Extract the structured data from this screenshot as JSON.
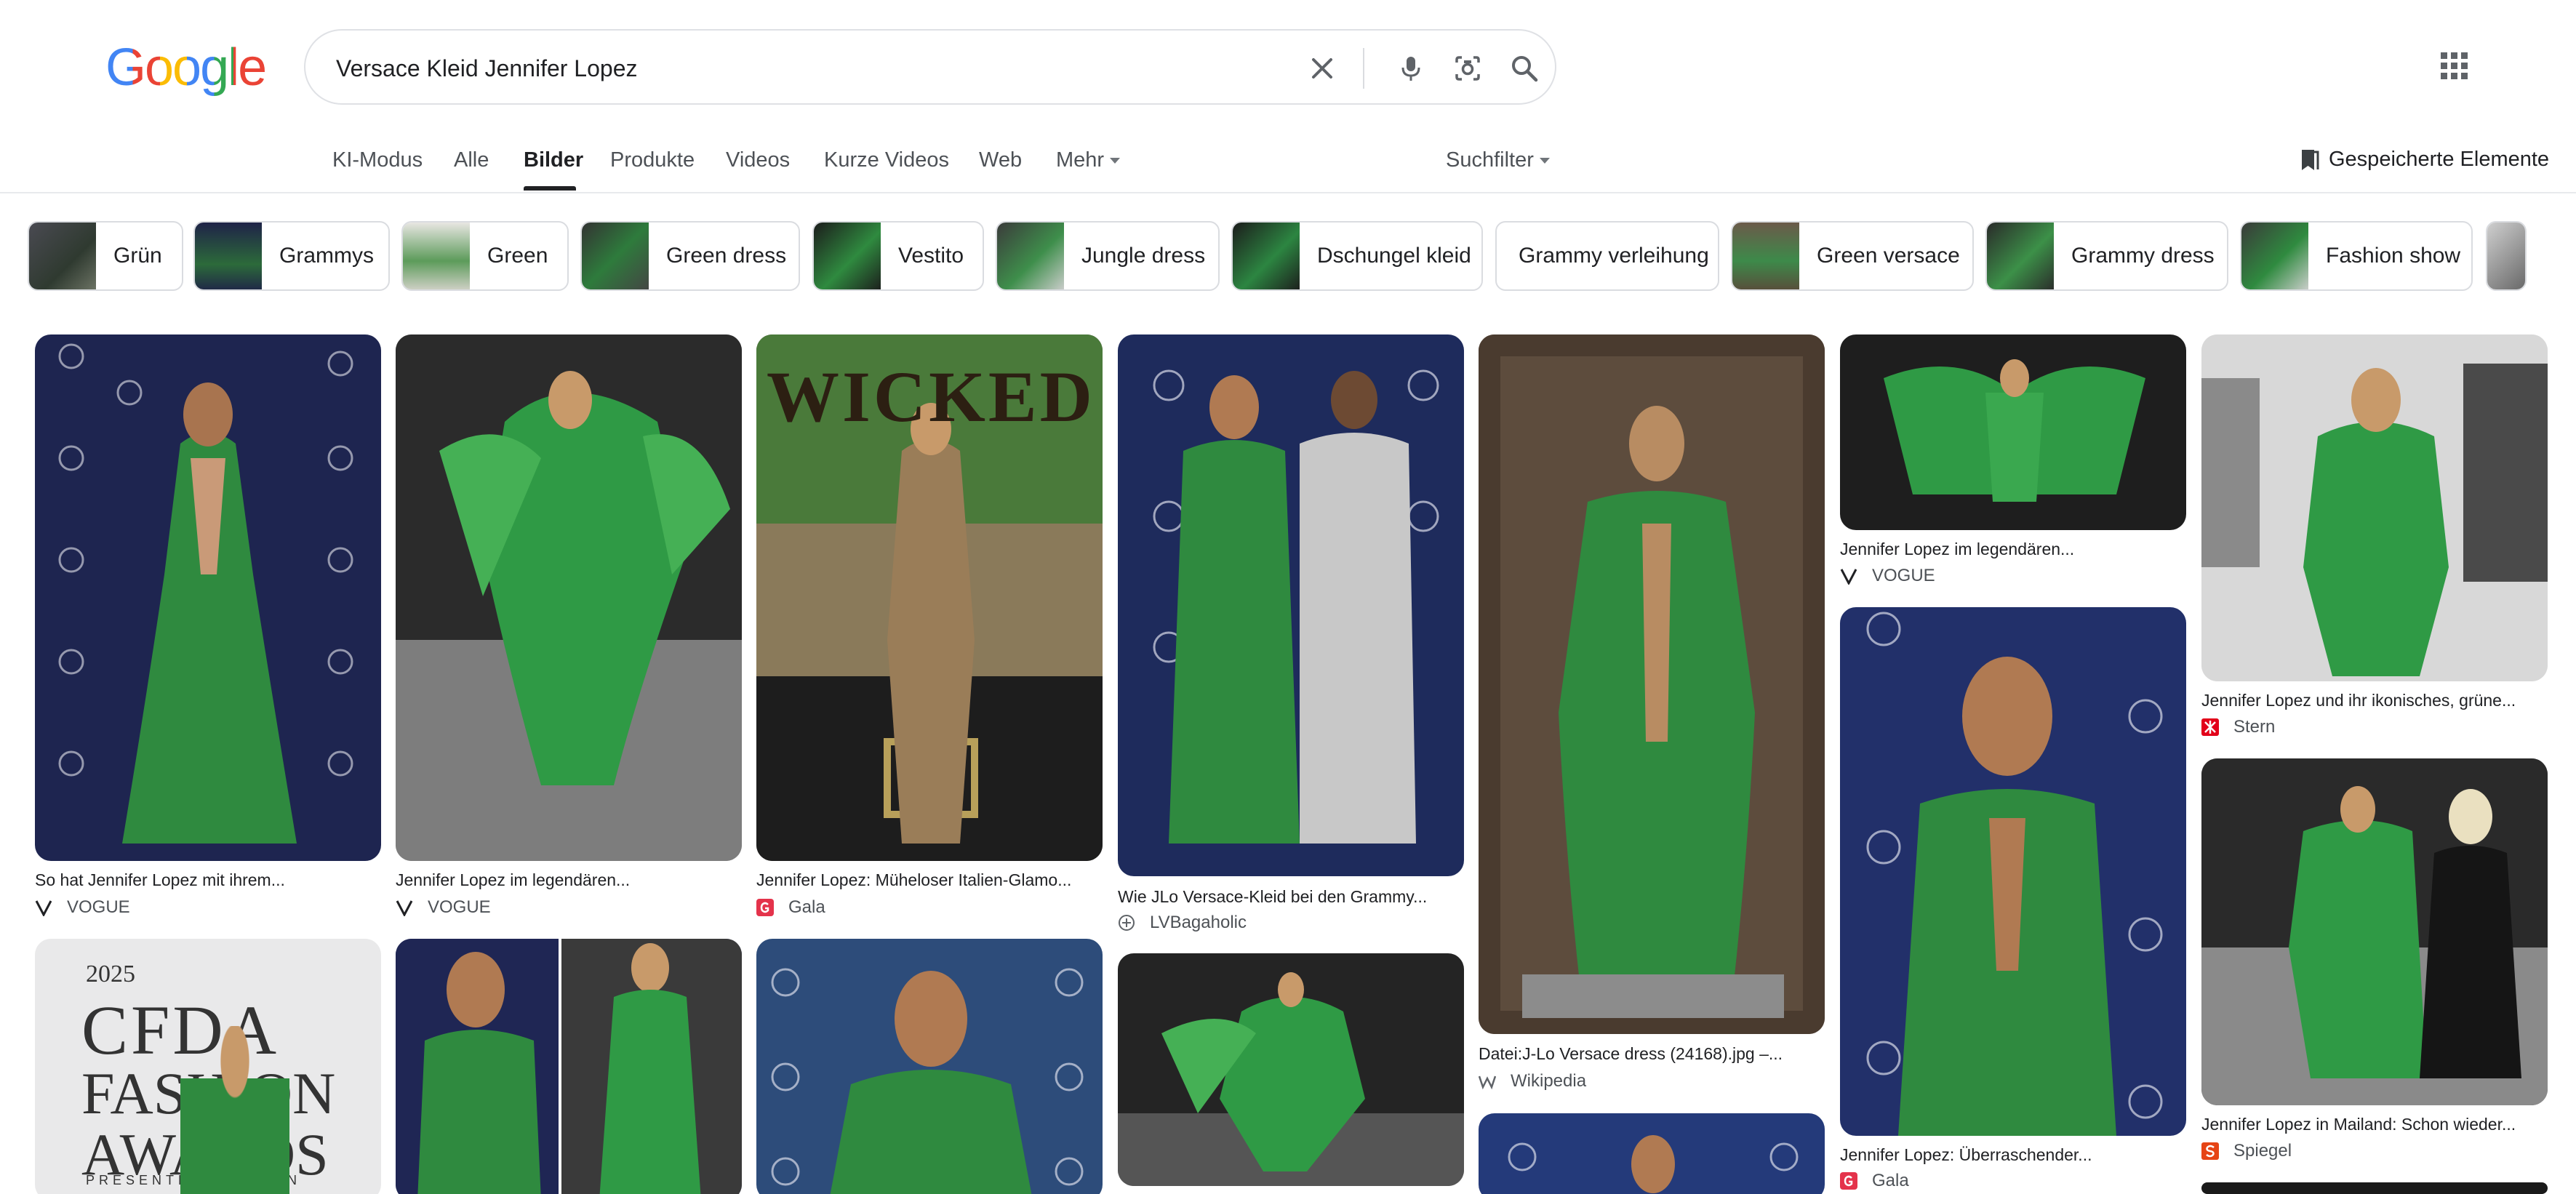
{
  "logo_text": "Google",
  "logo_colors": [
    "#4285f4",
    "#ea4335",
    "#fbbc05",
    "#4285f4",
    "#34a853",
    "#ea4335"
  ],
  "search": {
    "query": "Versace Kleid Jennifer Lopez"
  },
  "icons": {
    "clear": "close-icon",
    "voice": "microphone-icon",
    "lens": "lens-icon",
    "search": "search-icon",
    "apps": "apps-grid-icon",
    "saved": "bookmark-icon"
  },
  "nav": {
    "tabs": [
      "KI-Modus",
      "Alle",
      "Bilder",
      "Produkte",
      "Videos",
      "Kurze Videos",
      "Web",
      "Mehr"
    ],
    "active": "Bilder",
    "filter_label": "Suchfilter",
    "saved_label": "Gespeicherte Elemente"
  },
  "chips": [
    "Grün",
    "Grammys",
    "Green",
    "Green dress",
    "Vestito",
    "Jungle dress",
    "Dschungel kleid",
    "Grammy verleihung",
    "Green versace",
    "Grammy dress",
    "Fashion show"
  ],
  "results": [
    {
      "caption": "So hat Jennifer Lopez mit ihrem...",
      "source": "VOGUE"
    },
    {
      "caption": "Jennifer Lopez im legendären...",
      "source": "VOGUE"
    },
    {
      "caption": "Jennifer Lopez: Müheloser Italien-Glamo...",
      "source": "Gala"
    },
    {
      "caption": "Wie JLo Versace-Kleid bei den Grammy...",
      "source": "LVBagaholic"
    },
    {
      "caption": "Datei:J-Lo Versace dress (24168).jpg –...",
      "source": "Wikipedia"
    },
    {
      "caption": "Jennifer Lopez im legendären...",
      "source": "VOGUE"
    },
    {
      "caption": "Jennifer Lopez und ihr ikonisches, grüne...",
      "source": "Stern"
    },
    {
      "caption": "Jennifer Lopez: Überraschender...",
      "source": "Gala"
    },
    {
      "caption": "Jennifer Lopez in Mailand: Schon wieder...",
      "source": "Spiegel"
    }
  ],
  "cfda_image": {
    "year": "2025",
    "title_lines": [
      "CFDA",
      "FASHION",
      "AWARDS"
    ],
    "footer": "PRESENTED FASHION"
  },
  "wicked_sign": "WICKED",
  "colors": {
    "accent": "#1a73e8",
    "chip_border": "#dadce0",
    "gala": "#e4334b",
    "stern": "#e2001a",
    "spiegel": "#e64415"
  }
}
